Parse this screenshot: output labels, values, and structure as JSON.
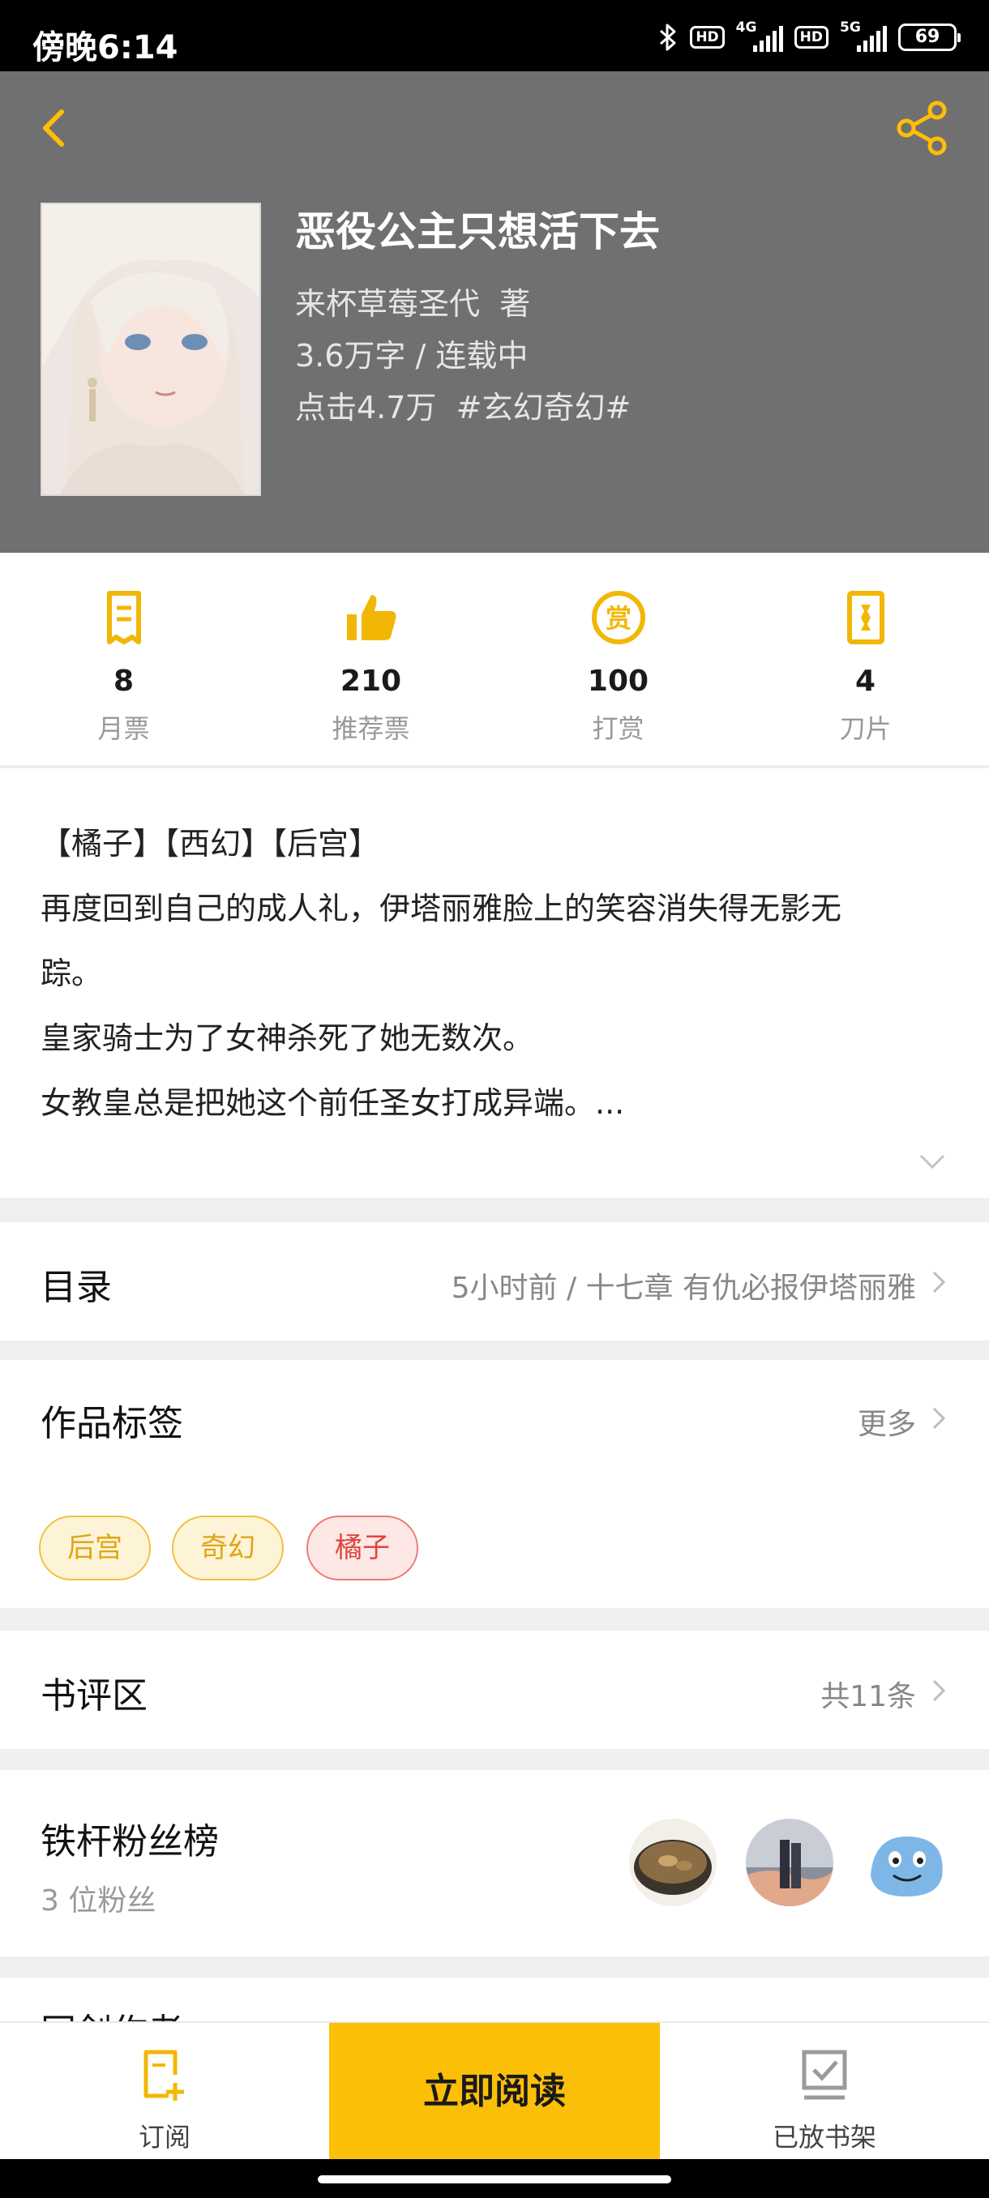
{
  "status_bar": {
    "time": "傍晚6:14",
    "hd1": "HD",
    "net1": "4G",
    "hd2": "HD",
    "net2": "5G",
    "battery": "69"
  },
  "book": {
    "title": "恶役公主只想活下去",
    "author": "来杯草莓圣代",
    "author_suffix": "著",
    "words": "3.6万字",
    "status": "连载中",
    "clicks": "点击4.7万",
    "genre": "#玄幻奇幻#"
  },
  "stats": [
    {
      "value": "8",
      "label": "月票",
      "icon": "monthly-ticket-icon"
    },
    {
      "value": "210",
      "label": "推荐票",
      "icon": "thumbs-up-icon"
    },
    {
      "value": "100",
      "label": "打赏",
      "icon": "reward-coin-icon"
    },
    {
      "value": "4",
      "label": "刀片",
      "icon": "blade-icon"
    }
  ],
  "description": {
    "line1": "【橘子】【西幻】【后宫】",
    "line2": "再度回到自己的成人礼，伊塔丽雅脸上的笑容消失得无影无",
    "line3": "踪。",
    "line4": "皇家骑士为了女神杀死了她无数次。",
    "line5": "女教皇总是把她这个前任圣女打成异端。..."
  },
  "toc": {
    "title": "目录",
    "latest": "5小时前 / 十七章 有仇必报伊塔丽雅"
  },
  "tags": {
    "title": "作品标签",
    "more": "更多",
    "items": [
      "后宫",
      "奇幻",
      "橘子"
    ]
  },
  "reviews": {
    "title": "书评区",
    "count": "共11条"
  },
  "fans": {
    "title": "铁杆粉丝榜",
    "count": "3 位粉丝"
  },
  "next_section_peek": "同剑作者",
  "bottom_bar": {
    "subscribe": "订阅",
    "read_now": "立即阅读",
    "on_shelf": "已放书架"
  },
  "colors": {
    "accent": "#fcbf08",
    "hero_bg": "#707070",
    "tag_red": "#e0443e"
  }
}
